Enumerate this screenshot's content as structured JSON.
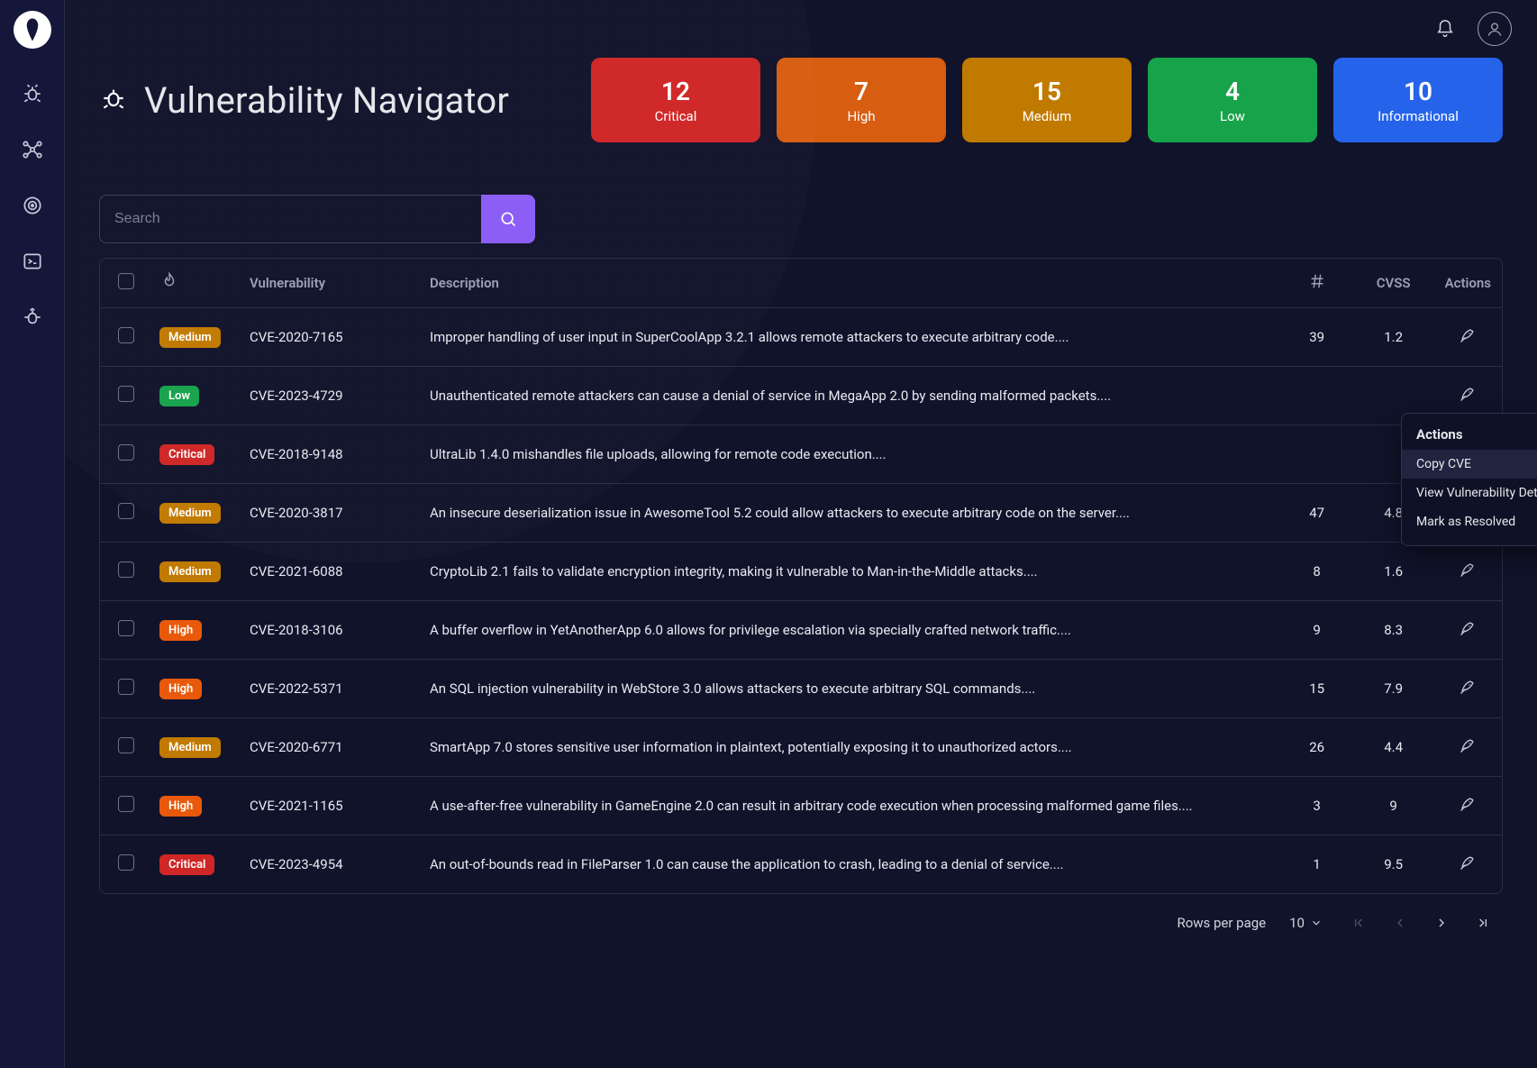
{
  "page": {
    "title": "Vulnerability Navigator"
  },
  "search": {
    "placeholder": "Search",
    "value": ""
  },
  "stats": [
    {
      "value": "12",
      "label": "Critical",
      "cls": "stat-critical"
    },
    {
      "value": "7",
      "label": "High",
      "cls": "stat-high"
    },
    {
      "value": "15",
      "label": "Medium",
      "cls": "stat-medium"
    },
    {
      "value": "4",
      "label": "Low",
      "cls": "stat-low"
    },
    {
      "value": "10",
      "label": "Informational",
      "cls": "stat-info"
    }
  ],
  "columns": {
    "vulnerability": "Vulnerability",
    "description": "Description",
    "cvss": "CVSS",
    "actions": "Actions"
  },
  "rows": [
    {
      "severity": "Medium",
      "sev_cls": "badge-medium",
      "cve": "CVE-2020-7165",
      "desc": "Improper handling of user input in SuperCoolApp 3.2.1 allows remote attackers to execute arbitrary code....",
      "count": "39",
      "cvss": "1.2"
    },
    {
      "severity": "Low",
      "sev_cls": "badge-low",
      "cve": "CVE-2023-4729",
      "desc": "Unauthenticated remote attackers can cause a denial of service in MegaApp 2.0 by sending malformed packets....",
      "count": "",
      "cvss": ""
    },
    {
      "severity": "Critical",
      "sev_cls": "badge-critical",
      "cve": "CVE-2018-9148",
      "desc": "UltraLib 1.4.0 mishandles file uploads, allowing for remote code execution....",
      "count": "",
      "cvss": ""
    },
    {
      "severity": "Medium",
      "sev_cls": "badge-medium",
      "cve": "CVE-2020-3817",
      "desc": "An insecure deserialization issue in AwesomeTool 5.2 could allow attackers to execute arbitrary code on the server....",
      "count": "47",
      "cvss": "4.8"
    },
    {
      "severity": "Medium",
      "sev_cls": "badge-medium",
      "cve": "CVE-2021-6088",
      "desc": "CryptoLib 2.1 fails to validate encryption integrity, making it vulnerable to Man-in-the-Middle attacks....",
      "count": "8",
      "cvss": "1.6"
    },
    {
      "severity": "High",
      "sev_cls": "badge-high",
      "cve": "CVE-2018-3106",
      "desc": "A buffer overflow in YetAnotherApp 6.0 allows for privilege escalation via specially crafted network traffic....",
      "count": "9",
      "cvss": "8.3"
    },
    {
      "severity": "High",
      "sev_cls": "badge-high",
      "cve": "CVE-2022-5371",
      "desc": "An SQL injection vulnerability in WebStore 3.0 allows attackers to execute arbitrary SQL commands....",
      "count": "15",
      "cvss": "7.9"
    },
    {
      "severity": "Medium",
      "sev_cls": "badge-medium",
      "cve": "CVE-2020-6771",
      "desc": "SmartApp 7.0 stores sensitive user information in plaintext, potentially exposing it to unauthorized actors....",
      "count": "26",
      "cvss": "4.4"
    },
    {
      "severity": "High",
      "sev_cls": "badge-high",
      "cve": "CVE-2021-1165",
      "desc": "A use-after-free vulnerability in GameEngine 2.0 can result in arbitrary code execution when processing malformed game files....",
      "count": "3",
      "cvss": "9"
    },
    {
      "severity": "Critical",
      "sev_cls": "badge-critical",
      "cve": "CVE-2023-4954",
      "desc": "An out-of-bounds read in FileParser 1.0 can cause the application to crash, leading to a denial of service....",
      "count": "1",
      "cvss": "9.5"
    }
  ],
  "context_menu": {
    "title": "Actions",
    "items": [
      {
        "label": "Copy CVE",
        "hover": true
      },
      {
        "label": "View Vulnerability Details",
        "hover": false
      },
      {
        "label": "Mark as Resolved",
        "hover": false
      }
    ]
  },
  "pagination": {
    "rows_per_page_label": "Rows per page",
    "rows_per_page_value": "10"
  }
}
